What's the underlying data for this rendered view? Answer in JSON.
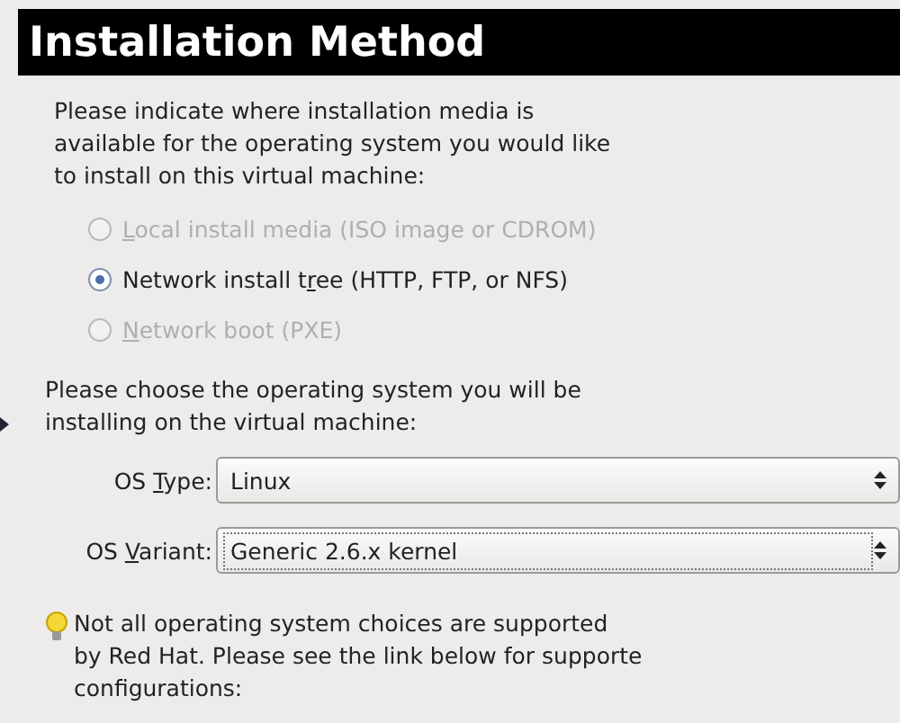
{
  "header": {
    "title": "Installation Method"
  },
  "intro": {
    "lines": [
      "Please indicate where installation media is",
      "available for the operating system you would like",
      "to install on this virtual machine:"
    ]
  },
  "methods": [
    {
      "label_parts": {
        "key": "L",
        "after": "ocal install media (ISO image or CDROM)"
      },
      "selected": false,
      "disabled": true
    },
    {
      "label_parts": {
        "before": "Network install t",
        "key": "r",
        "after": "ee (HTTP, FTP, or NFS)"
      },
      "selected": true,
      "disabled": false
    },
    {
      "label_parts": {
        "key": "N",
        "after": "etwork boot (PXE)"
      },
      "selected": false,
      "disabled": true
    }
  ],
  "os_prompt": {
    "lines": [
      "Please choose the operating system you will be",
      "installing on the virtual machine:"
    ]
  },
  "selects": [
    {
      "label_parts": {
        "before": "OS ",
        "key": "T",
        "after": "ype:"
      },
      "value": "Linux",
      "focused": false
    },
    {
      "label_parts": {
        "before": "OS ",
        "key": "V",
        "after": "ariant:"
      },
      "value": "Generic 2.6.x kernel",
      "focused": true
    }
  ],
  "note": {
    "lines": [
      "Not all operating system choices are supported",
      "by Red Hat. Please see the link below for supporte",
      "configurations:"
    ]
  }
}
